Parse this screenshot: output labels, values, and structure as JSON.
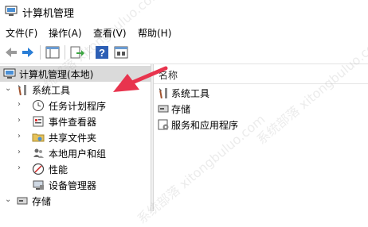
{
  "window": {
    "title": "计算机管理"
  },
  "menu": [
    "文件(F)",
    "操作(A)",
    "查看(V)",
    "帮助(H)"
  ],
  "toolbar": {
    "buttons": [
      "back-icon",
      "forward-icon",
      "show-hide-tree-icon",
      "export-list-icon",
      "help-icon",
      "properties-icon"
    ]
  },
  "tree": {
    "root": "计算机管理(本地)",
    "system_tools": "系统工具",
    "items": [
      "任务计划程序",
      "事件查看器",
      "共享文件夹",
      "本地用户和组",
      "性能",
      "设备管理器"
    ],
    "storage": "存储"
  },
  "list": {
    "header": "名称",
    "items": [
      "系统工具",
      "存储",
      "服务和应用程序"
    ]
  },
  "watermark": "系统部落 xitongbuluo.com",
  "colors": {
    "arrow": "#e8344e",
    "selection": "#dadada",
    "nav_arrow": "#2a7ed6"
  }
}
